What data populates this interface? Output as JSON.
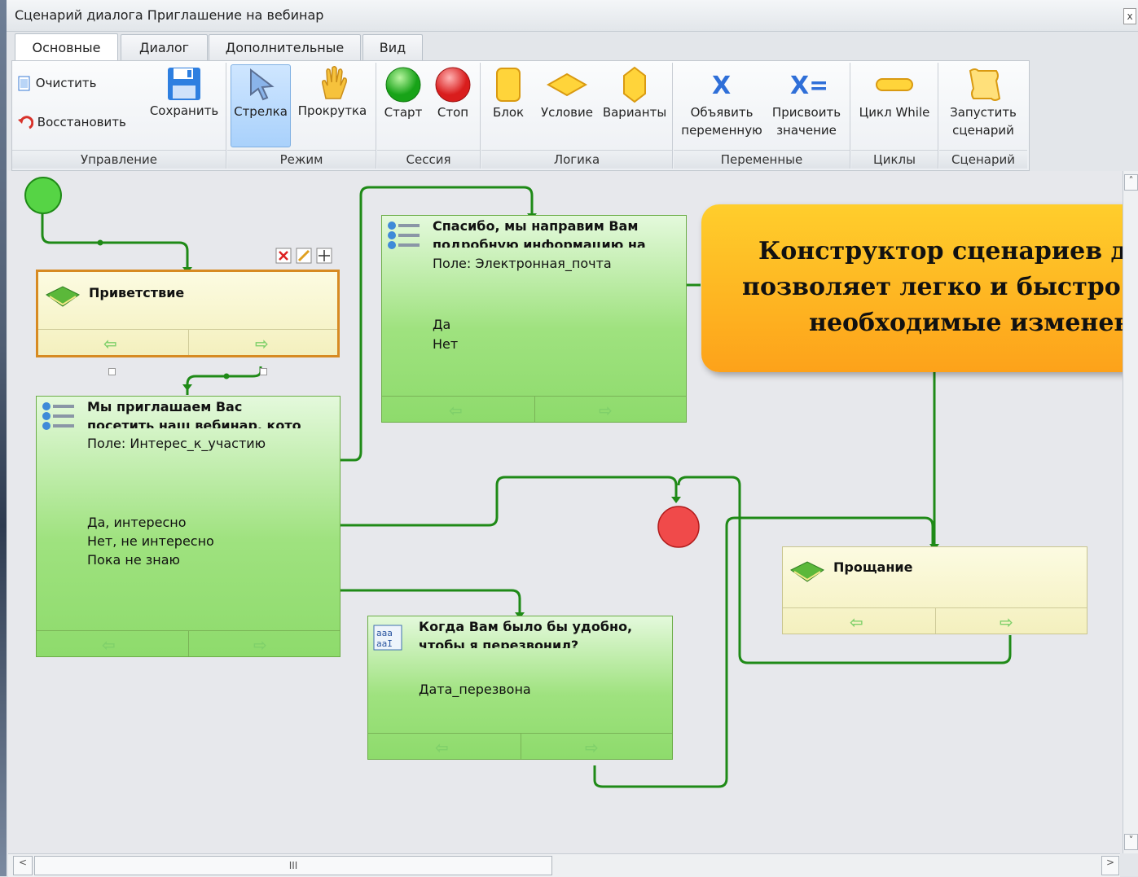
{
  "window": {
    "title": "Сценарий диалога Приглашение на вебинар",
    "close": "x"
  },
  "tabs": [
    "Основные",
    "Диалог",
    "Дополнительные",
    "Вид"
  ],
  "ribbon": {
    "clear": "Очистить",
    "restore": "Восстановить",
    "save": "Сохранить",
    "arrow": "Стрелка",
    "scroll": "Прокрутка",
    "start": "Старт",
    "stop": "Стоп",
    "block": "Блок",
    "condition": "Условие",
    "variants": "Варианты",
    "declare_var_1": "Объявить",
    "declare_var_2": "переменную",
    "assign_1": "Присвоить",
    "assign_2": "значение",
    "while": "Цикл While",
    "run_1": "Запустить",
    "run_2": "сценарий",
    "groups": [
      "Управление",
      "Режим",
      "Сессия",
      "Логика",
      "Переменные",
      "Циклы",
      "Сценарий"
    ]
  },
  "nodes": {
    "greeting": {
      "title": "Приветствие"
    },
    "invite": {
      "title_1": "Мы приглашаем Вас",
      "title_2": "посетить наш вебинар, кото",
      "field": "Поле: Интерес_к_участию",
      "options": [
        "Да, интересно",
        "Нет, не интересно",
        "Пока не знаю"
      ]
    },
    "thanks": {
      "title_1": "Спасибо, мы направим Вам",
      "title_2": "подробную информацию на",
      "field": "Поле: Электронная_почта",
      "options": [
        "Да",
        "Нет"
      ]
    },
    "callback": {
      "title_1": "Когда Вам было бы удобно,",
      "title_2": "чтобы я перезвонил?",
      "field": "Дата_перезвона"
    },
    "farewell": {
      "title": "Прощание"
    }
  },
  "callout": {
    "line1": "Конструктор сценариев диа",
    "line2": "позволяет легко и быстро вн",
    "line3": "необходимые изменения"
  },
  "scroll": {
    "thumb": "III"
  },
  "colors": {
    "accent": "#2e8b1e",
    "start": "#3cc43c",
    "stop": "#e63a3a",
    "callout": "#fdb320"
  }
}
